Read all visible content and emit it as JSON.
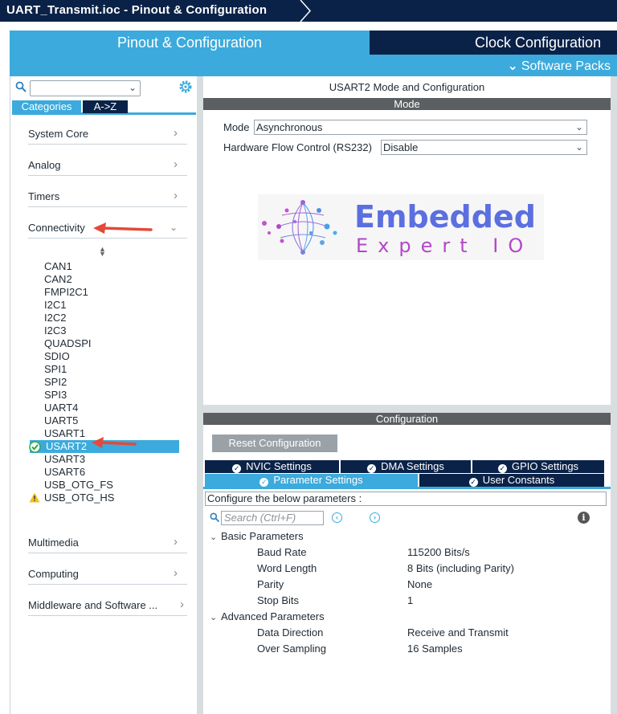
{
  "window": {
    "title": "UART_Transmit.ioc - Pinout & Configuration"
  },
  "main_tabs": {
    "pinout": "Pinout & Configuration",
    "clock": "Clock Configuration"
  },
  "software_packs": "Software Packs",
  "left": {
    "search_value": "",
    "view_tabs": {
      "categories": "Categories",
      "az": "A->Z"
    },
    "categories": [
      {
        "label": "System Core"
      },
      {
        "label": "Analog"
      },
      {
        "label": "Timers"
      },
      {
        "label": "Connectivity"
      },
      {
        "label": "Multimedia"
      },
      {
        "label": "Computing"
      },
      {
        "label": "Middleware and Software ..."
      }
    ],
    "connectivity_items": [
      "CAN1",
      "CAN2",
      "FMPI2C1",
      "I2C1",
      "I2C2",
      "I2C3",
      "QUADSPI",
      "SDIO",
      "SPI1",
      "SPI2",
      "SPI3",
      "UART4",
      "UART5",
      "USART1",
      "USART2",
      "USART3",
      "USART6",
      "USB_OTG_FS",
      "USB_OTG_HS"
    ],
    "selected_item": "USART2"
  },
  "right": {
    "title": "USART2 Mode and Configuration",
    "mode_header": "Mode",
    "mode_label": "Mode",
    "mode_value": "Asynchronous",
    "flow_label": "Hardware Flow Control (RS232)",
    "flow_value": "Disable",
    "logo": {
      "line1": "Embedded",
      "line2": "Expert IO"
    },
    "config_header": "Configuration",
    "reset_button": "Reset Configuration",
    "tabs": {
      "nvic": "NVIC Settings",
      "dma": "DMA Settings",
      "gpio": "GPIO Settings",
      "params": "Parameter Settings",
      "user": "User Constants"
    },
    "configure_note": "Configure the below parameters :",
    "search_placeholder": "Search (Ctrl+F)",
    "basic": {
      "title": "Basic Parameters",
      "params": [
        {
          "name": "Baud Rate",
          "value": "115200 Bits/s"
        },
        {
          "name": "Word Length",
          "value": "8 Bits (including Parity)"
        },
        {
          "name": "Parity",
          "value": "None"
        },
        {
          "name": "Stop Bits",
          "value": "1"
        }
      ]
    },
    "advanced": {
      "title": "Advanced Parameters",
      "params": [
        {
          "name": "Data Direction",
          "value": "Receive and Transmit"
        },
        {
          "name": "Over Sampling",
          "value": "16 Samples"
        }
      ]
    }
  },
  "colors": {
    "navy": "#0b2248",
    "accent": "#3caadc",
    "header_gray": "#5b5f62",
    "arrow_red": "#e24a3b"
  },
  "icons": [
    "search-icon",
    "gear-icon",
    "chevron-right-icon",
    "chevron-down-icon",
    "check-circle-icon",
    "warning-icon",
    "info-icon",
    "arrow-left-icon",
    "arrow-right-icon"
  ]
}
